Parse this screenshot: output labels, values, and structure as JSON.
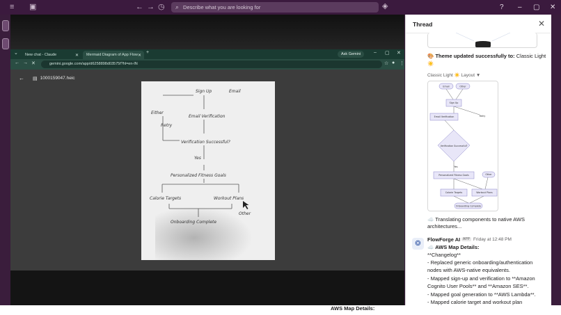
{
  "slack": {
    "search_placeholder": "Describe what you are looking for",
    "thread_title": "Thread",
    "ghost_heading": "AWS Map Details:"
  },
  "chrome": {
    "tabs": [
      {
        "label": "New chat - Claude",
        "active": false
      },
      {
        "label": "Mermaid Diagram of App Flow",
        "active": true
      }
    ],
    "ask_gemini": "Ask Gemini",
    "url": "gemini.google.com/app/d6258898d03575f?hl=en-IN",
    "file_name": "1000159047.heic"
  },
  "sketch": {
    "labels": [
      "Sign Up",
      "Email",
      "Email Verification",
      "Either",
      "Retry",
      "Verification Successful?",
      "Yes",
      "Personalized Fitness Goals",
      "Calorie Targets",
      "Workout Plans",
      "Other",
      "Onboarding Complete"
    ]
  },
  "thread": {
    "theme_msg_bold": "Theme updated successfully to:",
    "theme_msg_value": "Classic Light",
    "theme_emoji": "☀️",
    "layout_label": "Classic Light ☀️ Layout",
    "diagram_nodes": [
      "Email",
      "Other",
      "Sign Up",
      "Email Verification",
      "Retry",
      "Verification Successful?",
      "Yes",
      "Personalized Fitness Goals",
      "Other",
      "Calorie Targets",
      "Workout Plans",
      "Onboarding Complete"
    ],
    "translating": "☁️ Translating components to native AWS architectures...",
    "sender": "FlowForge AI",
    "app_badge": "APP",
    "time": "Friday at 12:48 PM",
    "aws_heading": "☁️ AWS Map Details:",
    "changelog_lines": [
      "**Changelog**",
      "- Replaced generic onboarding/authentication",
      "nodes with AWS-native equivalents.",
      "- Mapped sign-up and verification to **Amazon",
      "Cognito User Pools** and **Amazon SES**.",
      "- Mapped goal generation to **AWS Lambda**.",
      "- Mapped calorie target and workout plan"
    ]
  },
  "colors": {
    "slack_aubergine": "#3b1a3e",
    "chrome_green": "#2a4d43",
    "diagram_purple": "#e8e6f8"
  }
}
